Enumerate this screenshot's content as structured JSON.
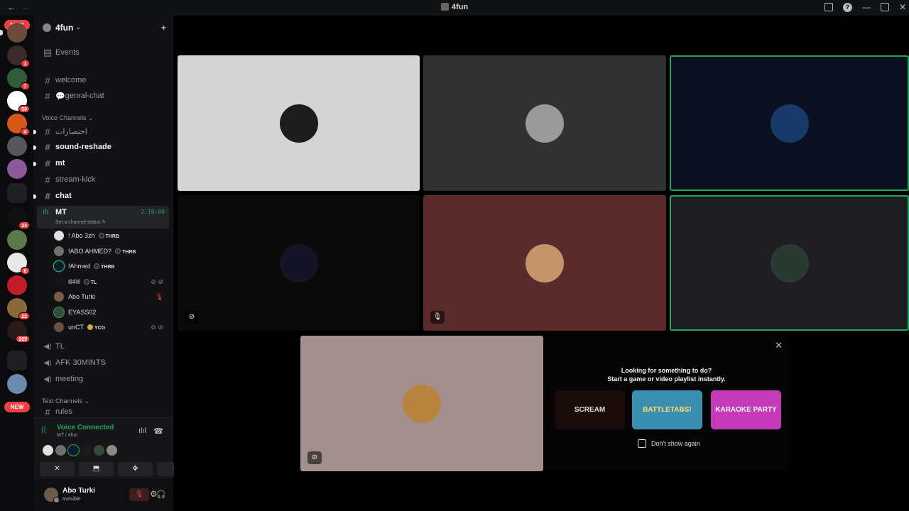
{
  "window": {
    "title": "4fun",
    "nav_back": "←",
    "nav_forward": "→",
    "minimize": "—",
    "close": "✕",
    "help": "?"
  },
  "rail": {
    "new_top": "NEW",
    "new_bottom": "NEW",
    "badges": [
      "1",
      "7",
      "50",
      "4",
      "24",
      "6",
      "22",
      "269"
    ]
  },
  "guild": {
    "name": "4fun",
    "caret": "⌄",
    "invite_icon": "person-add-icon"
  },
  "sidebar": {
    "events": "Events",
    "text_top": [
      {
        "label": "welcome"
      },
      {
        "label": "genral-chat",
        "emoji": "💬"
      }
    ],
    "voice_category": "Voice Channels ⌄",
    "channels": [
      {
        "label": "اختصارات",
        "bold": false
      },
      {
        "label": "sound-reshade",
        "bold": true
      },
      {
        "label": "mt",
        "bold": true
      },
      {
        "label": "stream-kick",
        "bold": false
      },
      {
        "label": "chat",
        "bold": true
      }
    ],
    "active_voice": {
      "name": "MT",
      "timer": "2:10:00",
      "status": "Set a channel status ✎"
    },
    "voice_users": [
      {
        "name": "! Abo 3zh",
        "tag": "THRB"
      },
      {
        "name": "!ABO AHMED?",
        "tag": "THRB"
      },
      {
        "name": "!Ahmed",
        "tag": "THRB"
      },
      {
        "name": "ℓℓ4ℓℓ",
        "tag": "TL",
        "muted": true
      },
      {
        "name": "Abo Turki",
        "live": true
      },
      {
        "name": "EYASS02"
      },
      {
        "name": "unCT",
        "tag": "YCG",
        "muted": true
      }
    ],
    "voice_channels": [
      "TL",
      "AFK 30MINTS",
      "meeting"
    ],
    "text_category": "Text Channels ⌄",
    "rules": "rules"
  },
  "voice_panel": {
    "title": "Voice Connected",
    "subtitle": "MT / 4fun",
    "buttons": [
      "✕",
      "⬒",
      "✥",
      "✧"
    ]
  },
  "user": {
    "name": "Abo Turki",
    "status": "Invisible",
    "mic_icon": "🎙",
    "headset_icon": "🎧",
    "settings_icon": "⚙"
  },
  "stage": {
    "tiles": [
      {
        "name": "tile-user-1",
        "bg": "#d4d4d4",
        "avatar": "#1c1c1c",
        "speaking": false
      },
      {
        "name": "tile-user-2",
        "bg": "#313131",
        "avatar": "#9a9a9a",
        "speaking": false
      },
      {
        "name": "tile-user-3",
        "bg": "#0b1020",
        "avatar": "#173a6a",
        "speaking": true
      },
      {
        "name": "tile-user-4",
        "bg": "#0a0a0a",
        "avatar": "#141426",
        "speaking": false,
        "flag": "⊘"
      },
      {
        "name": "tile-user-5",
        "bg": "#5b2a2a",
        "avatar": "#c4956a",
        "speaking": false,
        "flag": "🎙"
      },
      {
        "name": "tile-user-6",
        "bg": "#1d1d22",
        "avatar": "#2a3a32",
        "speaking": true
      },
      {
        "name": "tile-user-7",
        "bg": "#a3908e",
        "avatar": "#b9853e",
        "speaking": false,
        "flag": "⊘"
      }
    ],
    "promo": {
      "line1": "Looking for something to do?",
      "line2": "Start a game or video playlist instantly.",
      "close": "✕",
      "games": [
        {
          "label": "SCREAM",
          "bg": "#1a0b0b",
          "fg": "#e8e0d8"
        },
        {
          "label": "BATTLETABS!",
          "bg": "#3a8fb0",
          "fg": "#ffe066"
        },
        {
          "label": "KARAOKE PARTY",
          "bg": "#c43ab8",
          "fg": "#ffffff"
        }
      ],
      "dont_show": "Don't show again"
    }
  }
}
